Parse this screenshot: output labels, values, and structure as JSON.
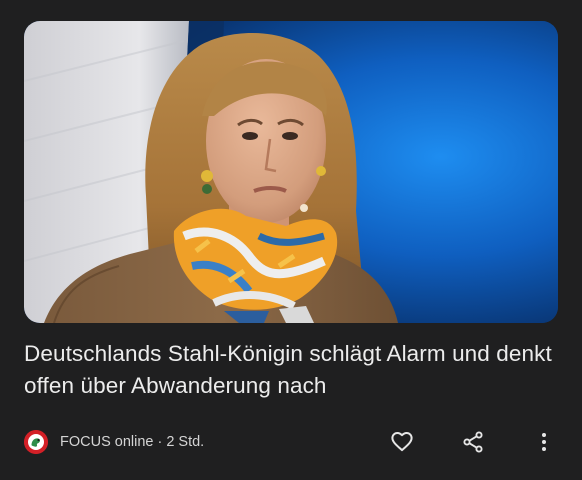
{
  "article": {
    "image_alt": "Frau mit blonden Haaren und orange-blau gemustertem Schal vor blauem Hintergrund",
    "headline": "Deutschlands Stahl-Königin schlägt Alarm und denkt offen über Abwanderung nach",
    "source": "FOCUS online",
    "separator": "·",
    "age": "2 Std."
  },
  "icons": {
    "source_logo": "focus-online-logo",
    "like": "heart-outline-icon",
    "share": "share-icon",
    "more": "more-vert-icon"
  },
  "colors": {
    "background": "#1f1f20",
    "headline_text": "#ececec",
    "meta_text": "#d4d4d4",
    "icon": "#e6e6e6",
    "source_logo_red": "#d32027",
    "photo_blue": "#1160c4"
  }
}
